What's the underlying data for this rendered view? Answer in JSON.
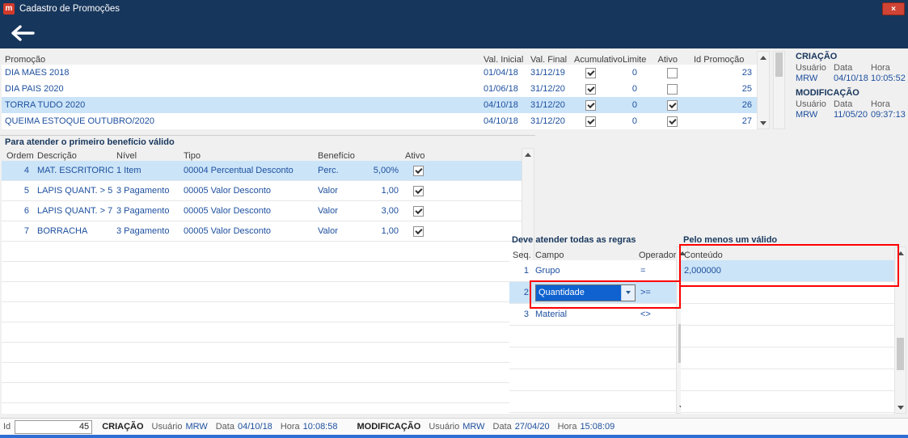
{
  "window": {
    "title": "Cadastro de Promoções",
    "icon_glyph": "m",
    "close_glyph": "×"
  },
  "colors": {
    "titlebar": "#17365c",
    "selection": "#cbe4f8",
    "data_text": "#1d4f9e",
    "combo_selection": "#0f62cf",
    "annotation": "#fe0000",
    "bottom_strip": "#2e6ed2"
  },
  "promotions_grid": {
    "columns": {
      "promocao": "Promoção",
      "val_inicial": "Val. Inicial",
      "val_final": "Val. Final",
      "acumulativo": "Acumulativo",
      "limite": "Limite",
      "ativo": "Ativo",
      "id_promocao": "Id Promoção"
    },
    "rows": [
      {
        "promocao": "DIA MAES 2018",
        "val_inicial": "01/04/18",
        "val_final": "31/12/19",
        "acumulativo": true,
        "limite": "0",
        "ativo": false,
        "id": "23",
        "selected": false
      },
      {
        "promocao": "DIA PAIS 2020",
        "val_inicial": "01/06/18",
        "val_final": "31/12/20",
        "acumulativo": true,
        "limite": "0",
        "ativo": false,
        "id": "25",
        "selected": false
      },
      {
        "promocao": "TORRA TUDO 2020",
        "val_inicial": "04/10/18",
        "val_final": "31/12/20",
        "acumulativo": true,
        "limite": "0",
        "ativo": true,
        "id": "26",
        "selected": true
      },
      {
        "promocao": "QUEIMA ESTOQUE OUTUBRO/2020",
        "val_inicial": "04/10/18",
        "val_final": "31/12/20",
        "acumulativo": true,
        "limite": "0",
        "ativo": true,
        "id": "27",
        "selected": false
      }
    ]
  },
  "audit_panel": {
    "criacao_title": "CRIAÇÃO",
    "modificacao_title": "MODIFICAÇÃO",
    "headers": {
      "usuario": "Usuário",
      "data": "Data",
      "hora": "Hora"
    },
    "criacao": {
      "usuario": "MRW",
      "data": "04/10/18",
      "hora": "10:05:52"
    },
    "modificacao": {
      "usuario": "MRW",
      "data": "11/05/20",
      "hora": "09:37:13"
    }
  },
  "beneficios_grid": {
    "title": "Para atender o primeiro benefício válido",
    "columns": {
      "ordem": "Ordem",
      "descricao": "Descrição",
      "nivel": "Nível",
      "tipo": "Tipo",
      "beneficio": "Benefício",
      "ativo": "Ativo"
    },
    "rows": [
      {
        "ordem": "4",
        "descricao": "MAT. ESCRITORIO",
        "nivel": "1 Item",
        "tipo": "00004 Percentual Desconto",
        "beneficio": "Perc.",
        "valor": "5,00%",
        "ativo": true,
        "selected": true
      },
      {
        "ordem": "5",
        "descricao": "LAPIS QUANT. > 5",
        "nivel": "3 Pagamento",
        "tipo": "00005 Valor Desconto",
        "beneficio": "Valor",
        "valor": "1,00",
        "ativo": true,
        "selected": false
      },
      {
        "ordem": "6",
        "descricao": "LAPIS QUANT. > 7",
        "nivel": "3 Pagamento",
        "tipo": "00005 Valor Desconto",
        "beneficio": "Valor",
        "valor": "3,00",
        "ativo": true,
        "selected": false
      },
      {
        "ordem": "7",
        "descricao": "BORRACHA",
        "nivel": "3 Pagamento",
        "tipo": "00005 Valor Desconto",
        "beneficio": "Valor",
        "valor": "1,00",
        "ativo": true,
        "selected": false
      }
    ]
  },
  "regras_grid": {
    "title": "Deve atender todas as regras",
    "columns": {
      "seq": "Seq.",
      "campo": "Campo",
      "operador": "Operador"
    },
    "rows": [
      {
        "seq": "1",
        "campo": "Grupo",
        "operador": "=",
        "selected": false,
        "combo": false
      },
      {
        "seq": "2",
        "campo": "Quantidade",
        "operador": ">=",
        "selected": true,
        "combo": true
      },
      {
        "seq": "3",
        "campo": "Material",
        "operador": "<>",
        "selected": false,
        "combo": false
      }
    ]
  },
  "conteudo_grid": {
    "title": "Pelo menos um válido",
    "columns": {
      "conteudo": "Conteúdo"
    },
    "rows": [
      {
        "conteudo": "2,000000",
        "selected": true
      }
    ]
  },
  "statusbar": {
    "id_label": "Id",
    "id_value": "45",
    "criacao_label": "CRIAÇÃO",
    "modificacao_label": "MODIFICAÇÃO",
    "usuario_label": "Usuário",
    "data_label": "Data",
    "hora_label": "Hora",
    "criacao": {
      "usuario": "MRW",
      "data": "04/10/18",
      "hora": "10:08:58"
    },
    "modificacao": {
      "usuario": "MRW",
      "data": "27/04/20",
      "hora": "15:08:09"
    }
  }
}
